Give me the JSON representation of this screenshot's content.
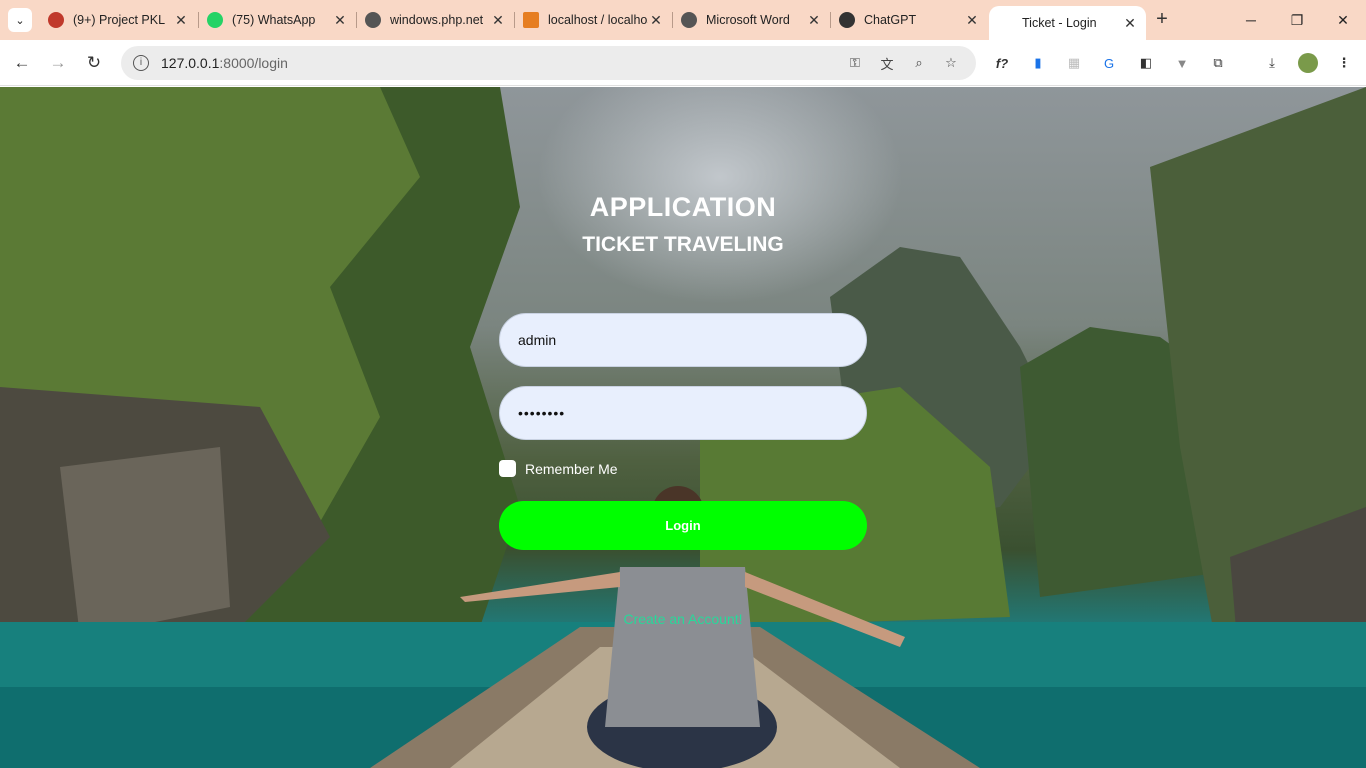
{
  "browser": {
    "tabs": [
      {
        "title": "(9+) Project PKL",
        "fav_color": "#c0392b",
        "icon": "project-icon"
      },
      {
        "title": "(75) WhatsApp",
        "fav_color": "#25d366",
        "icon": "whatsapp-icon"
      },
      {
        "title": "windows.php.net",
        "fav_color": "#555555",
        "icon": "globe-icon"
      },
      {
        "title": "localhost / localhost",
        "fav_color": "#e67e22",
        "icon": "phpmyadmin-icon"
      },
      {
        "title": "Microsoft Word",
        "fav_color": "#555555",
        "icon": "globe-icon"
      },
      {
        "title": "ChatGPT",
        "fav_color": "#333333",
        "icon": "chatgpt-icon"
      },
      {
        "title": "Ticket - Login",
        "fav_color": "#ffffff",
        "icon": "page-icon"
      }
    ],
    "close_glyph": "✕",
    "new_tab_glyph": "+",
    "url_host": "127.0.0.1",
    "url_path": ":8000/login"
  },
  "login": {
    "title_line1": "APPLICATION",
    "title_line2": "TICKET TRAVELING",
    "username_value": "admin",
    "password_value": "••••••••",
    "remember_label": "Remember Me",
    "button_label": "Login",
    "create_account_link": "Create an Account!"
  },
  "colors": {
    "tabstrip": "#f9d8c6",
    "login_button": "#00ff00",
    "create_link": "#28d89a",
    "input_bg": "#e8effd"
  }
}
